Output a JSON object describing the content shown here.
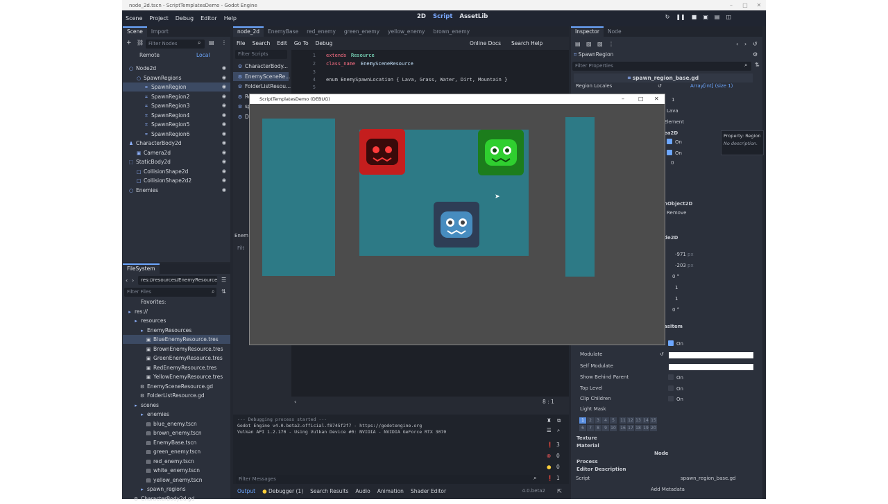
{
  "window": {
    "title": "node_2d.tscn - ScriptTemplatesDemo - Godot Engine"
  },
  "menu": [
    "Scene",
    "Project",
    "Debug",
    "Editor",
    "Help"
  ],
  "workspaces": {
    "2d": "2D",
    "script": "Script",
    "assetlib": "AssetLib"
  },
  "scene_panel": {
    "tabs": [
      "Scene",
      "Import"
    ],
    "filter_placeholder": "Filter Nodes",
    "remote": "Remote",
    "local": "Local",
    "nodes": [
      "Node2d",
      "SpawnRegions",
      "SpawnRegion",
      "SpawnRegion2",
      "SpawnRegion3",
      "SpawnRegion4",
      "SpawnRegion5",
      "SpawnRegion6",
      "CharacterBody2d",
      "Camera2d",
      "StaticBody2d",
      "CollisionShape2d",
      "CollisionShape2d2",
      "Enemies"
    ]
  },
  "filesystem": {
    "tab": "FileSystem",
    "path": "res://resources/EnemyResource",
    "filter_placeholder": "Filter Files",
    "items": [
      "Favorites:",
      "res://",
      "resources",
      "EnemyResources",
      "BlueEnemyResource.tres",
      "BrownEnemyResource.tres",
      "GreenEnemyResource.tres",
      "RedEnemyResource.tres",
      "YellowEnemyResource.tres",
      "EnemySceneResource.gd",
      "FolderListResource.gd",
      "scenes",
      "enemies",
      "blue_enemy.tscn",
      "brown_enemy.tscn",
      "EnemyBase.tscn",
      "green_enemy.tscn",
      "red_enemy.tscn",
      "white_enemy.tscn",
      "yellow_enemy.tscn",
      "spawn_regions",
      "CharacterBody2d.gd"
    ]
  },
  "script_tabs": [
    "node_2d",
    "EnemyBase",
    "red_enemy",
    "green_enemy",
    "yellow_enemy",
    "brown_enemy"
  ],
  "script_menu": [
    "File",
    "Search",
    "Edit",
    "Go To",
    "Debug"
  ],
  "online_docs": "Online Docs",
  "search_help": "Search Help",
  "scripts_filter": "Filter Scripts",
  "script_list": [
    "CharacterBody...",
    "EnemySceneRe...",
    "FolderListResou...",
    "Re",
    "sp",
    "De"
  ],
  "code": {
    "line_numbers": [
      "1",
      "2",
      "3",
      "4",
      "5"
    ],
    "kw_extends": "extends",
    "cls_resource": "Resource",
    "kw_class_name": "class_name",
    "cls_name": "EnemySceneResource",
    "enum_line": "enum EnemySpawnLocation { Lava, Grass, Water, Dirt, Mountain }"
  },
  "lower_panel": {
    "enemies": "Enem",
    "filter": "Filt"
  },
  "status": {
    "position": "8 :   1"
  },
  "debug_window": {
    "title": "ScriptTemplatesDemo (DEBUG)"
  },
  "output": {
    "lines": [
      "--- Debugging process started ---",
      "Godot Engine v4.0.beta2.official.f8745f2f7 - https://godotengine.org",
      "Vulkan API 1.2.170 - Using Vulkan Device #0: NVIDIA - NVIDIA GeForce RTX 3070"
    ],
    "filter": "Filter Messages",
    "counts": [
      "3",
      "0",
      "0",
      "1"
    ]
  },
  "bottom_tabs": [
    "Output",
    "Debugger (1)",
    "Search Results",
    "Audio",
    "Animation",
    "Shader Editor"
  ],
  "version": "4.0.beta2",
  "inspector": {
    "tabs": [
      "Inspector",
      "Node"
    ],
    "node": "SpawnRegion",
    "filter": "Filter Properties",
    "script_file": "spawn_region_base.gd",
    "region_locales": "Region Locales",
    "region_value": "Array[int] (size 1)",
    "size_val": "1",
    "lava": "Lava",
    "add_element": "Element",
    "area2d": "ea2D",
    "on1": "On",
    "on2": "On",
    "zero": "0",
    "tooltip_prop": "Property: Region",
    "tooltip_desc": "No description.",
    "colobj": "nObject2D",
    "remove": "Remove",
    "node2d": "de2D",
    "x": "-971",
    "y": "-203",
    "px": "px",
    "rot": "0 °",
    "sx": "1",
    "sy": "1",
    "skew": "0 °",
    "canvas": "asItem",
    "visible_on": "On",
    "modulate": "Modulate",
    "self_modulate": "Self Modulate",
    "show_behind": "Show Behind Parent",
    "top_level": "Top Level",
    "clip": "Clip Children",
    "on_a": "On",
    "on_b": "On",
    "on_c": "On",
    "light_mask": "Light Mask",
    "layers1": [
      "1",
      "2",
      "3",
      "4",
      "5",
      "11",
      "12",
      "13",
      "14",
      "15"
    ],
    "layers2": [
      "6",
      "7",
      "8",
      "9",
      "10",
      "16",
      "17",
      "18",
      "19",
      "20"
    ],
    "texture": "Texture",
    "material": "Material",
    "node_sect": "Node",
    "process": "Process",
    "editor_desc": "Editor Description",
    "script_lbl": "Script",
    "script_val": "spawn_region_base.gd",
    "add_meta": "Add Metadata"
  },
  "colors": {
    "accent": "#6da7ff",
    "teal": "#2d7a86",
    "red": "#c41e1e",
    "green": "#22b022",
    "blue": "#3c5478"
  }
}
